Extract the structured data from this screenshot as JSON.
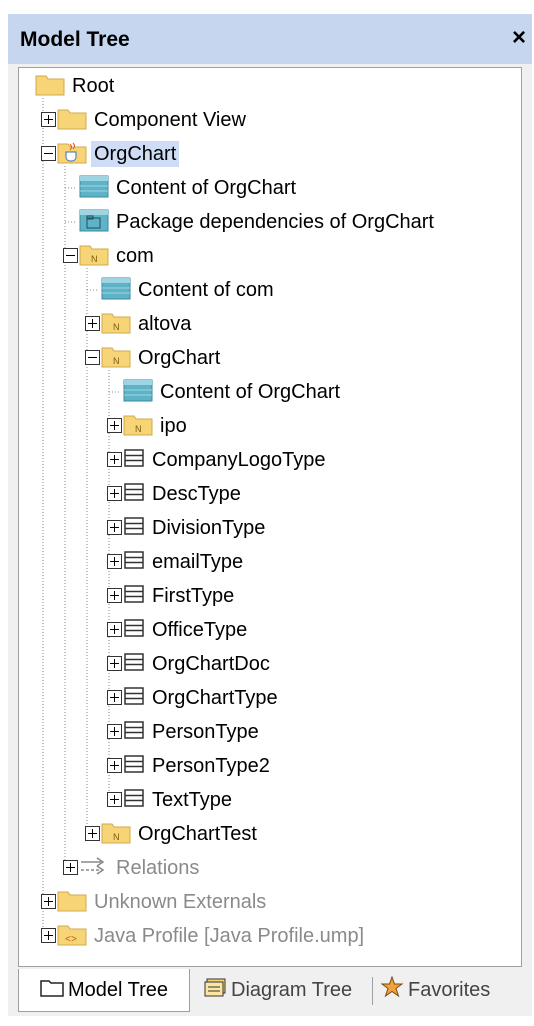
{
  "panel": {
    "title": "Model Tree",
    "close_glyph": "×"
  },
  "tree": [
    {
      "label": "Root",
      "level": 0,
      "icon": "folder-icon"
    },
    {
      "label": "Component View",
      "level": 1,
      "icon": "folder-icon",
      "expander": "plus"
    },
    {
      "label": "OrgChart",
      "level": 1,
      "icon": "java-package-icon",
      "expander": "minus",
      "selected": true
    },
    {
      "label": "Content of OrgChart",
      "level": 2,
      "icon": "diagram-icon"
    },
    {
      "label": "Package dependencies of OrgChart",
      "level": 2,
      "icon": "package-diagram-icon"
    },
    {
      "label": "com",
      "level": 2,
      "icon": "namespace-folder-icon",
      "expander": "minus"
    },
    {
      "label": "Content of com",
      "level": 3,
      "icon": "diagram-icon"
    },
    {
      "label": "altova",
      "level": 3,
      "icon": "namespace-folder-icon",
      "expander": "plus"
    },
    {
      "label": "OrgChart",
      "level": 3,
      "icon": "namespace-folder-icon",
      "expander": "minus"
    },
    {
      "label": "Content of OrgChart",
      "level": 4,
      "icon": "diagram-icon"
    },
    {
      "label": "ipo",
      "level": 4,
      "icon": "namespace-folder-icon",
      "expander": "plus"
    },
    {
      "label": "CompanyLogoType",
      "level": 4,
      "icon": "class-icon",
      "expander": "plus"
    },
    {
      "label": "DescType",
      "level": 4,
      "icon": "class-icon",
      "expander": "plus"
    },
    {
      "label": "DivisionType",
      "level": 4,
      "icon": "class-icon",
      "expander": "plus"
    },
    {
      "label": "emailType",
      "level": 4,
      "icon": "class-icon",
      "expander": "plus"
    },
    {
      "label": "FirstType",
      "level": 4,
      "icon": "class-icon",
      "expander": "plus"
    },
    {
      "label": "OfficeType",
      "level": 4,
      "icon": "class-icon",
      "expander": "plus"
    },
    {
      "label": "OrgChartDoc",
      "level": 4,
      "icon": "class-icon",
      "expander": "plus"
    },
    {
      "label": "OrgChartType",
      "level": 4,
      "icon": "class-icon",
      "expander": "plus"
    },
    {
      "label": "PersonType",
      "level": 4,
      "icon": "class-icon",
      "expander": "plus"
    },
    {
      "label": "PersonType2",
      "level": 4,
      "icon": "class-icon",
      "expander": "plus"
    },
    {
      "label": "TextType",
      "level": 4,
      "icon": "class-icon",
      "expander": "plus"
    },
    {
      "label": "OrgChartTest",
      "level": 3,
      "icon": "namespace-folder-icon",
      "expander": "plus"
    },
    {
      "label": "Relations",
      "level": 2,
      "icon": "relations-icon",
      "expander": "plus",
      "grey": true
    },
    {
      "label": "Unknown Externals",
      "level": 1,
      "icon": "folder-icon",
      "expander": "plus",
      "grey": true
    },
    {
      "label": "Java Profile [Java Profile.ump]",
      "level": 1,
      "icon": "profile-icon",
      "expander": "plus",
      "grey": true
    }
  ],
  "tabs": [
    {
      "label": "Model Tree",
      "icon": "folder-outline-icon",
      "active": true
    },
    {
      "label": "Diagram Tree",
      "icon": "diagram-tree-icon"
    },
    {
      "label": "Favorites",
      "icon": "favorites-star-icon"
    }
  ],
  "colors": {
    "titlebar": "#c5d6ee",
    "selection": "#cfdcf5",
    "folder": "#f7d577",
    "diagram": "#5fb3c7"
  }
}
